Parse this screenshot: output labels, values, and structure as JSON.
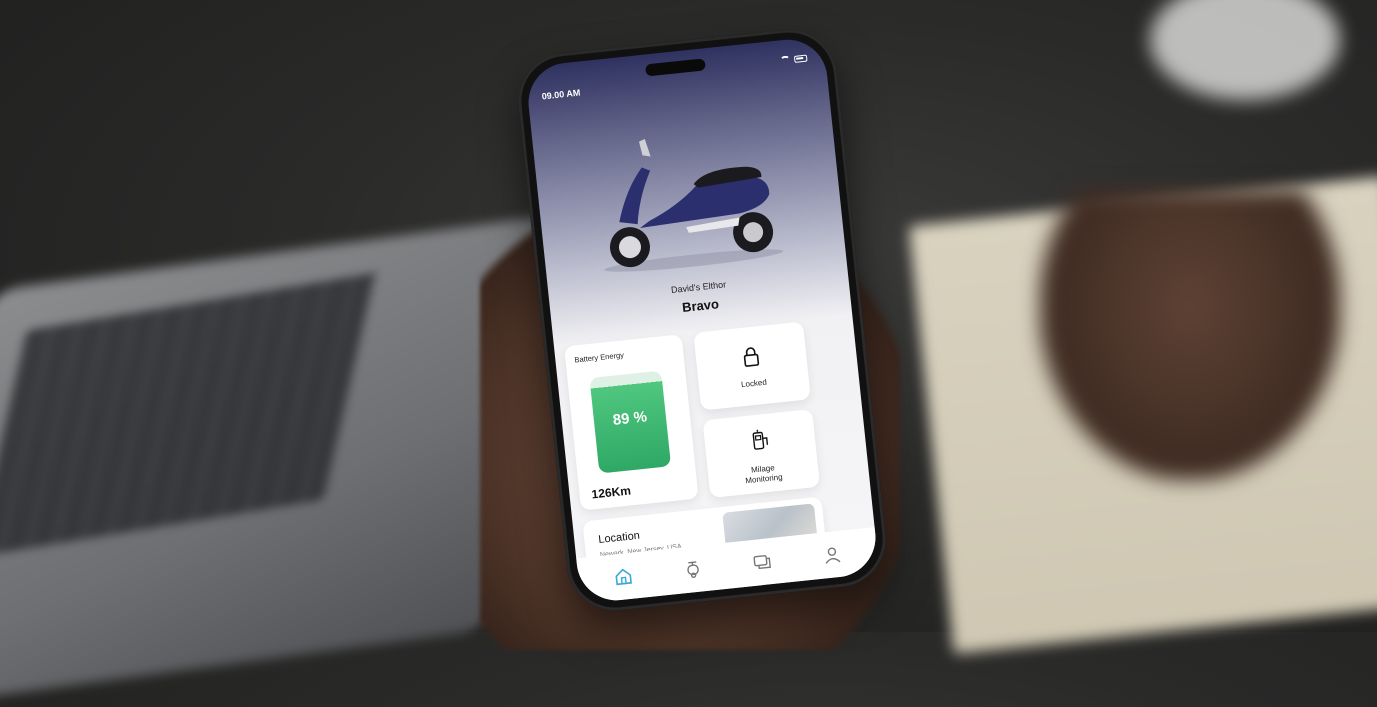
{
  "status_bar": {
    "time": "09.00 AM"
  },
  "vehicle": {
    "owner": "David's Elthor",
    "model": "Bravo"
  },
  "battery_card": {
    "title": "Battery Energy",
    "level_text": "89 %",
    "level_percent": 89,
    "range": "126Km"
  },
  "lock_card": {
    "label": "Locked"
  },
  "milage_card": {
    "label_line1": "Milage",
    "label_line2": "Monitoring"
  },
  "location_card": {
    "title": "Location",
    "address": "Newark, New Jersey, USA"
  },
  "nav": {
    "items": [
      "home-icon",
      "scooter-icon",
      "chat-icon",
      "profile-icon"
    ],
    "active": "home-icon"
  },
  "colors": {
    "accent": "#3aa8d8",
    "battery_green": "#2fa866",
    "scooter_body": "#2b2f6e"
  }
}
